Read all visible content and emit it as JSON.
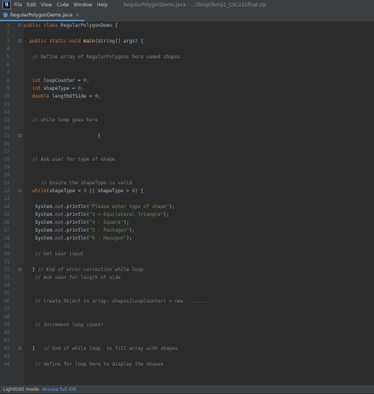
{
  "window": {
    "app_icon": "IJ",
    "menu": [
      "File",
      "Edit",
      "View",
      "Code",
      "Window",
      "Help"
    ],
    "title": "RegularPolygonDemo.java - ...\\Temp\\Temp1_CSC151final.zip"
  },
  "tab": {
    "label": "RegularPolygonDemo.java",
    "close": "×"
  },
  "status": {
    "mode_text": "LightEdit mode.",
    "link_text": "Access full IDE"
  },
  "editor": {
    "lines": [
      {
        "n": "1",
        "fold": true,
        "tokens": [
          {
            "t": "public class ",
            "c": "kw"
          },
          {
            "t": "RegularPolygonDemo {",
            "c": ""
          }
        ]
      },
      {
        "n": "2",
        "tokens": []
      },
      {
        "n": "3",
        "fold": true,
        "tokens": [
          {
            "t": "  public static void ",
            "c": "kw"
          },
          {
            "t": "main",
            "c": "mth"
          },
          {
            "t": "(String[] args) {",
            "c": ""
          }
        ]
      },
      {
        "n": "4",
        "tokens": []
      },
      {
        "n": "5",
        "tokens": [
          {
            "t": "   // Define array of RegularPolygons here named shapes",
            "c": "cmt"
          }
        ]
      },
      {
        "n": "6",
        "tokens": []
      },
      {
        "n": "7",
        "tokens": []
      },
      {
        "n": "8",
        "tokens": [
          {
            "t": "   int ",
            "c": "kw"
          },
          {
            "t": "loopCounter = ",
            "c": ""
          },
          {
            "t": "0",
            "c": "num"
          },
          {
            "t": ";",
            "c": "kw"
          }
        ]
      },
      {
        "n": "9",
        "tokens": [
          {
            "t": "   int ",
            "c": "kw"
          },
          {
            "t": "shapeType = ",
            "c": ""
          },
          {
            "t": "0",
            "c": "num"
          },
          {
            "t": ";",
            "c": "kw"
          }
        ]
      },
      {
        "n": "10",
        "tokens": [
          {
            "t": "   double ",
            "c": "kw"
          },
          {
            "t": "lengthOfSide = ",
            "c": ""
          },
          {
            "t": "0",
            "c": "num"
          },
          {
            "t": ";",
            "c": "kw"
          }
        ]
      },
      {
        "n": "11",
        "tokens": []
      },
      {
        "n": "12",
        "tokens": []
      },
      {
        "n": "13",
        "tokens": [
          {
            "t": "   // while loop goes here",
            "c": "cmt"
          }
        ]
      },
      {
        "n": "14",
        "tokens": []
      },
      {
        "n": "15",
        "fold": true,
        "tokens": [
          {
            "t": "                          {",
            "c": ""
          }
        ]
      },
      {
        "n": "16",
        "tokens": []
      },
      {
        "n": "17",
        "tokens": []
      },
      {
        "n": "18",
        "tokens": [
          {
            "t": "   // Ask user for type of shape",
            "c": "cmt"
          }
        ]
      },
      {
        "n": "19",
        "tokens": []
      },
      {
        "n": "20",
        "tokens": []
      },
      {
        "n": "21",
        "tokens": [
          {
            "t": "      // Ensure the shapeType is valid",
            "c": "cmt"
          }
        ]
      },
      {
        "n": "22",
        "fold": true,
        "tokens": [
          {
            "t": "   while",
            "c": "kw"
          },
          {
            "t": "(shapeType < ",
            "c": ""
          },
          {
            "t": "3",
            "c": "num"
          },
          {
            "t": " || shapeType > ",
            "c": ""
          },
          {
            "t": "6",
            "c": "num"
          },
          {
            "t": ") {",
            "c": ""
          }
        ]
      },
      {
        "n": "23",
        "tokens": []
      },
      {
        "n": "24",
        "tokens": [
          {
            "t": "    System.",
            "c": ""
          },
          {
            "t": "out",
            "c": "fld"
          },
          {
            "t": ".println(",
            "c": ""
          },
          {
            "t": "\"Please enter type of shape\"",
            "c": "str"
          },
          {
            "t": ");",
            "c": ""
          }
        ]
      },
      {
        "n": "25",
        "tokens": [
          {
            "t": "    System.",
            "c": ""
          },
          {
            "t": "out",
            "c": "fld"
          },
          {
            "t": ".println(",
            "c": ""
          },
          {
            "t": "\"3 = Equilateral Triangle\"",
            "c": "str"
          },
          {
            "t": ");",
            "c": ""
          }
        ]
      },
      {
        "n": "26",
        "tokens": [
          {
            "t": "    System.",
            "c": ""
          },
          {
            "t": "out",
            "c": "fld"
          },
          {
            "t": ".println(",
            "c": ""
          },
          {
            "t": "\"4 - Square\"",
            "c": "str"
          },
          {
            "t": ");",
            "c": ""
          }
        ]
      },
      {
        "n": "27",
        "tokens": [
          {
            "t": "    System.",
            "c": ""
          },
          {
            "t": "out",
            "c": "fld"
          },
          {
            "t": ".println(",
            "c": ""
          },
          {
            "t": "\"5 - Pentagon\"",
            "c": "str"
          },
          {
            "t": ");",
            "c": ""
          }
        ]
      },
      {
        "n": "28",
        "tokens": [
          {
            "t": "    System.",
            "c": ""
          },
          {
            "t": "out",
            "c": "fld"
          },
          {
            "t": ".println(",
            "c": ""
          },
          {
            "t": "\"6 - Hexagon\"",
            "c": "str"
          },
          {
            "t": ");",
            "c": ""
          }
        ]
      },
      {
        "n": "29",
        "tokens": []
      },
      {
        "n": "30",
        "tokens": [
          {
            "t": "    // Get user input",
            "c": "cmt"
          }
        ]
      },
      {
        "n": "31",
        "tokens": []
      },
      {
        "n": "32",
        "fold": true,
        "tokens": [
          {
            "t": "   } ",
            "c": ""
          },
          {
            "t": "// End of error correction while loop",
            "c": "cmt"
          }
        ]
      },
      {
        "n": "33",
        "tokens": [
          {
            "t": "    // Ask user for length of side",
            "c": "cmt"
          }
        ]
      },
      {
        "n": "34",
        "tokens": []
      },
      {
        "n": "35",
        "tokens": []
      },
      {
        "n": "36",
        "tokens": [
          {
            "t": "    // Create Object in array: shapes[loopCounter) = new  ........",
            "c": "cmt"
          }
        ]
      },
      {
        "n": "37",
        "tokens": []
      },
      {
        "n": "38",
        "tokens": []
      },
      {
        "n": "39",
        "tokens": [
          {
            "t": "    // Increment loop countr",
            "c": "cmt"
          }
        ]
      },
      {
        "n": "40",
        "tokens": []
      },
      {
        "n": "41",
        "tokens": []
      },
      {
        "n": "42",
        "fold": true,
        "tokens": [
          {
            "t": "   }   ",
            "c": ""
          },
          {
            "t": "// End of while loop  to fill array with shapes",
            "c": "cmt"
          }
        ]
      },
      {
        "n": "43",
        "tokens": []
      },
      {
        "n": "44",
        "tokens": [
          {
            "t": "    // define for loop here to display the shapes",
            "c": "cmt"
          }
        ]
      }
    ]
  }
}
